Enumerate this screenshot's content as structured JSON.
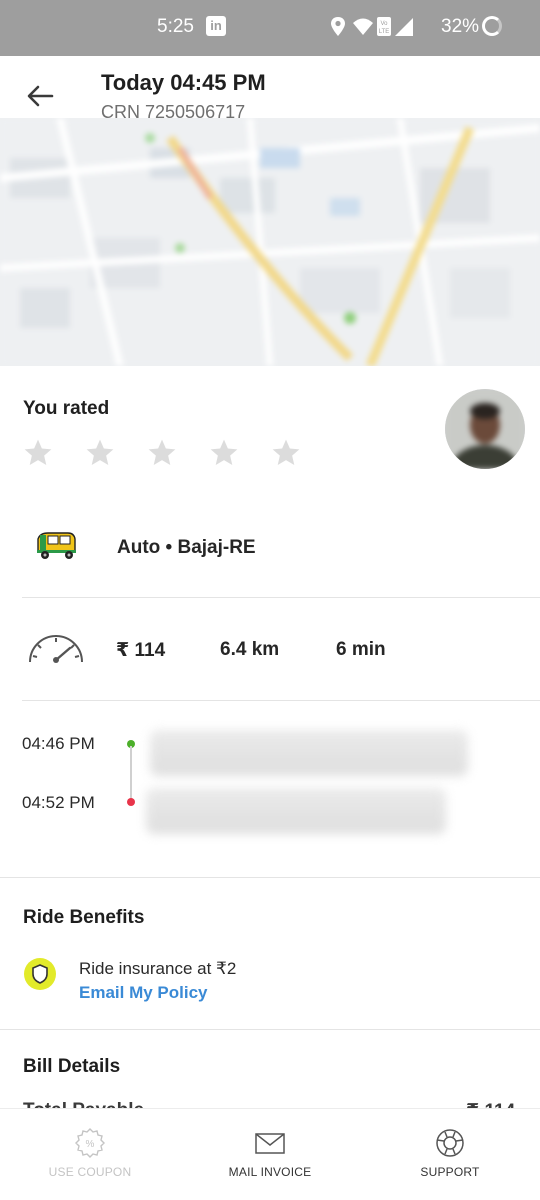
{
  "status_bar": {
    "time": "5:25",
    "battery": "32%",
    "linkedin_icon": "in"
  },
  "header": {
    "title": "Today 04:45 PM",
    "crn": "CRN 7250506717"
  },
  "rating": {
    "label": "You rated",
    "stars_total": 5,
    "stars_filled": 0
  },
  "vehicle": {
    "text": "Auto • Bajaj-RE"
  },
  "stats": {
    "fare": "₹ 114",
    "distance": "6.4 km",
    "duration": "6 min"
  },
  "timeline": {
    "pickup_time": "04:46 PM",
    "drop_time": "04:52 PM"
  },
  "benefits": {
    "title": "Ride Benefits",
    "insurance_text": "Ride insurance at ₹2",
    "link_text": "Email My Policy"
  },
  "bill": {
    "title": "Bill Details",
    "peek_label": "Total Payable",
    "peek_amount": "₹ 114"
  },
  "bottom_nav": [
    {
      "label": "USE COUPON",
      "icon": "coupon-icon",
      "enabled": false
    },
    {
      "label": "MAIL INVOICE",
      "icon": "mail-icon",
      "enabled": true
    },
    {
      "label": "SUPPORT",
      "icon": "support-icon",
      "enabled": true
    }
  ],
  "colors": {
    "link": "#3a8ad6",
    "pickup_dot": "#4caf2a",
    "drop_dot": "#e8344a",
    "shield": "#e2ea2a",
    "status_bar": "#9e9e9e"
  }
}
